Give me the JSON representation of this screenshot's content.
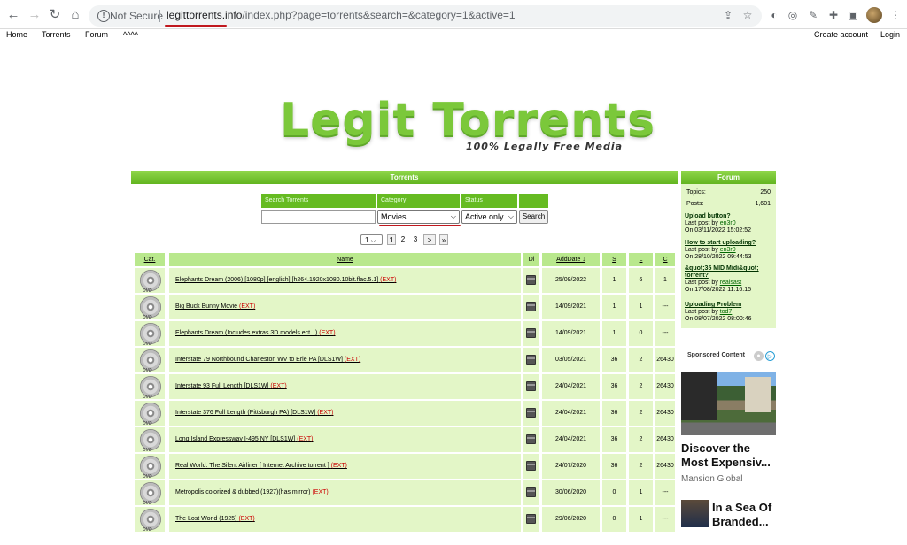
{
  "browser": {
    "security_label": "Not Secure",
    "url_host": "legittorrents.info",
    "url_path": "/index.php?page=torrents&search=&category=1&active=1"
  },
  "site_nav": {
    "left": [
      "Home",
      "Torrents",
      "Forum",
      "^^^^"
    ],
    "right": [
      "Create account",
      "Login"
    ]
  },
  "logo": {
    "title": "Legit Torrents",
    "subtitle": "100% Legally Free Media"
  },
  "torrents": {
    "header": "Torrents",
    "search_labels": {
      "search": "Search Torrents",
      "category": "Category",
      "status": "Status"
    },
    "search_value": "",
    "category_value": "Movies",
    "status_value": "Active only",
    "search_button": "Search",
    "pager": {
      "select": "1",
      "pages": [
        "1",
        "2",
        "3"
      ],
      "next": ">",
      "last": "»"
    },
    "columns": {
      "cat": "Cat.",
      "name": "Name",
      "dl": "Dl",
      "added": "AddDate ↓",
      "s": "S",
      "l": "L",
      "c": "C"
    },
    "rows": [
      {
        "name": "Elephants Dream (2006) [1080p] [english] [h264.1920x1080.10bit.flac.5.1]",
        "ext": "(EXT)",
        "date": "25/09/2022",
        "s": "1",
        "l": "6",
        "c": "1"
      },
      {
        "name": "Big Buck Bunny Movie",
        "ext": "(EXT)",
        "date": "14/09/2021",
        "s": "1",
        "l": "1",
        "c": "---"
      },
      {
        "name": "Elephants Dream (Includes extras 3D models ect...)",
        "ext": "(EXT)",
        "date": "14/09/2021",
        "s": "1",
        "l": "0",
        "c": "---"
      },
      {
        "name": "Interstate 79 Northbound Charleston WV to Erie PA [DLS1W]",
        "ext": "(EXT)",
        "date": "03/05/2021",
        "s": "36",
        "l": "2",
        "c": "26430"
      },
      {
        "name": "Interstate 93 Full Length [DLS1W]",
        "ext": "(EXT)",
        "date": "24/04/2021",
        "s": "36",
        "l": "2",
        "c": "26430"
      },
      {
        "name": "Interstate 376 Full Length (Pittsburgh PA) [DLS1W]",
        "ext": "(EXT)",
        "date": "24/04/2021",
        "s": "36",
        "l": "2",
        "c": "26430"
      },
      {
        "name": "Long Island Expressway I-495 NY [DLS1W]",
        "ext": "(EXT)",
        "date": "24/04/2021",
        "s": "36",
        "l": "2",
        "c": "26430"
      },
      {
        "name": "Real World: The Silent Airliner [ Internet Archive torrent ]",
        "ext": "(EXT)",
        "date": "24/07/2020",
        "s": "36",
        "l": "2",
        "c": "26430"
      },
      {
        "name": "Metropolis colorized & dubbed (1927)(has mirror)",
        "ext": "(EXT)",
        "date": "30/06/2020",
        "s": "0",
        "l": "1",
        "c": "---"
      },
      {
        "name": "The Lost World (1925)",
        "ext": "(EXT)",
        "date": "29/06/2020",
        "s": "0",
        "l": "1",
        "c": "---"
      }
    ]
  },
  "forum": {
    "header": "Forum",
    "topics_label": "Topics:",
    "topics_value": "250",
    "posts_label": "Posts:",
    "posts_value": "1,601",
    "posts": [
      {
        "title": "Upload button?",
        "by_prefix": "Last post by",
        "user": "en3r0",
        "on": "On 03/11/2022 15:02:52"
      },
      {
        "title": "How to start uploading?",
        "by_prefix": "Last post by",
        "user": "en3r0",
        "on": "On 28/10/2022 09:44:53"
      },
      {
        "title": "&quot;35 MID Midi&quot; torrent?",
        "by_prefix": "Last post by",
        "user": "realsast",
        "on": "On 17/08/2022 11:16:15"
      },
      {
        "title": "Uploading Problem",
        "by_prefix": "Last post by",
        "user": "tod7",
        "on": "On 08/07/2022 08:00:46"
      }
    ]
  },
  "sponsored": {
    "label": "Sponsored Content",
    "ad1_title": "Discover the Most Expensiv...",
    "ad1_source": "Mansion Global",
    "ad2_title": "In a Sea Of Branded..."
  }
}
